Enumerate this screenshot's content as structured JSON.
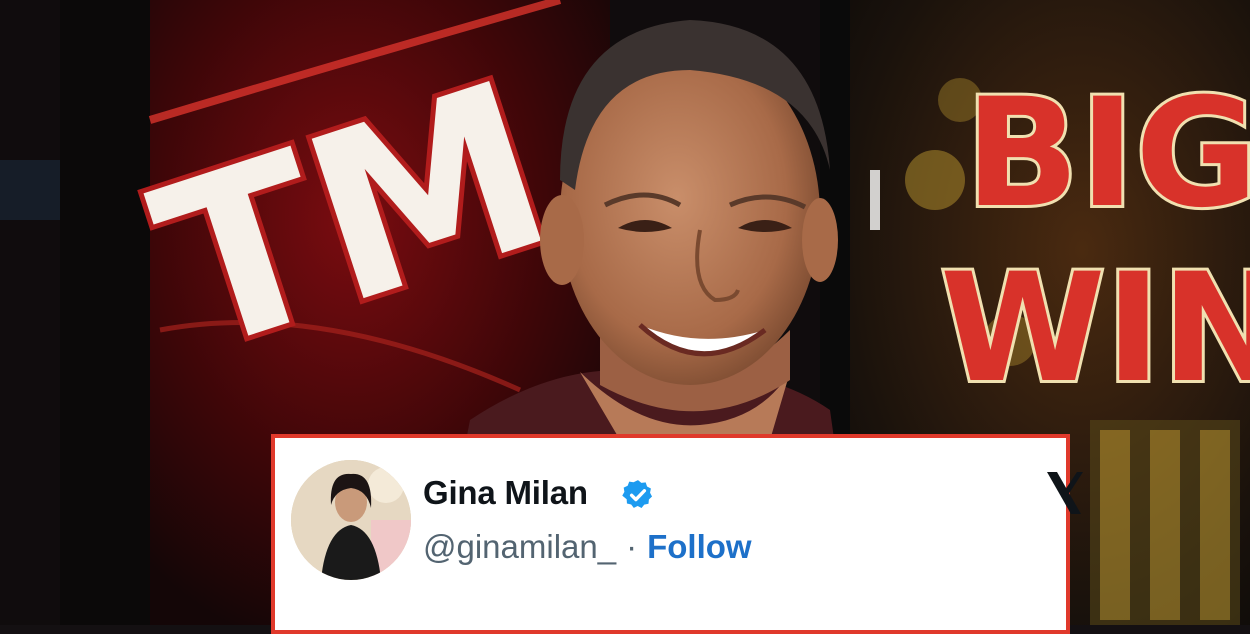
{
  "photo": {
    "sign_left_text": "TM",
    "sign_right_line1": "BIG",
    "sign_right_line2": "WIN"
  },
  "tweet": {
    "display_name": "Gina Milan",
    "handle": "@ginamilan_",
    "separator": "·",
    "follow_label": "Follow",
    "text_partial": "",
    "verified": true
  },
  "colors": {
    "card_border": "#e0392b",
    "verified_badge": "#1d9bf0",
    "follow_link": "#1d70c9"
  }
}
